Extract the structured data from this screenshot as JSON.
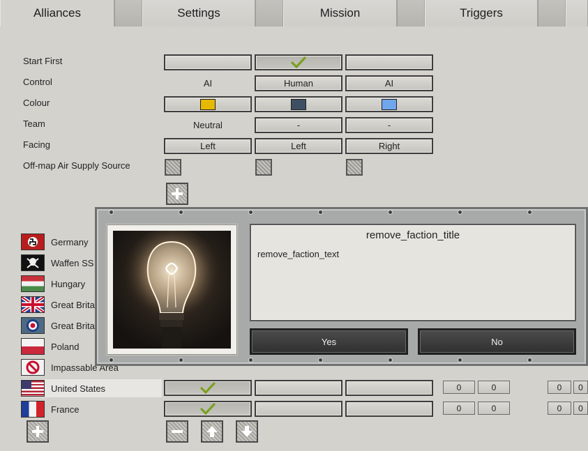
{
  "tabs": [
    {
      "label": "Alliances"
    },
    {
      "label": "Settings"
    },
    {
      "label": "Mission"
    },
    {
      "label": "Triggers"
    }
  ],
  "rows": {
    "start_first": "Start First",
    "control": "Control",
    "colour": "Colour",
    "team": "Team",
    "facing": "Facing",
    "air_supply": "Off-map Air Supply Source"
  },
  "columns": [
    {
      "control": "AI",
      "team": "Neutral",
      "facing": "Left",
      "colour": "#e6b800",
      "start_first": false
    },
    {
      "control": "Human",
      "team": "-",
      "facing": "Left",
      "colour": "#3f4f63",
      "start_first": true
    },
    {
      "control": "AI",
      "team": "-",
      "facing": "Right",
      "colour": "#6fa6ec",
      "start_first": false
    }
  ],
  "factions": [
    {
      "name": "Germany",
      "flag": "germany-flag"
    },
    {
      "name": "Waffen SS",
      "flag": "waffen-ss-flag"
    },
    {
      "name": "Hungary",
      "flag": "hungary-flag"
    },
    {
      "name": "Great Brita",
      "flag": "uk-flag"
    },
    {
      "name": "Great Brita",
      "flag": "raf-roundel-flag"
    },
    {
      "name": "Poland",
      "flag": "poland-flag"
    },
    {
      "name": "Impassable Area",
      "flag": "impassable-icon"
    },
    {
      "name": "United States",
      "flag": "us-flag",
      "selected": true
    },
    {
      "name": "France",
      "flag": "france-flag"
    }
  ],
  "numbers": {
    "zero": "0"
  },
  "dialog": {
    "title": "remove_faction_title",
    "text": "remove_faction_text",
    "yes": "Yes",
    "no": "No"
  },
  "colors": {
    "check": "#79a01f",
    "dialog_button": "#3a3a3a"
  }
}
